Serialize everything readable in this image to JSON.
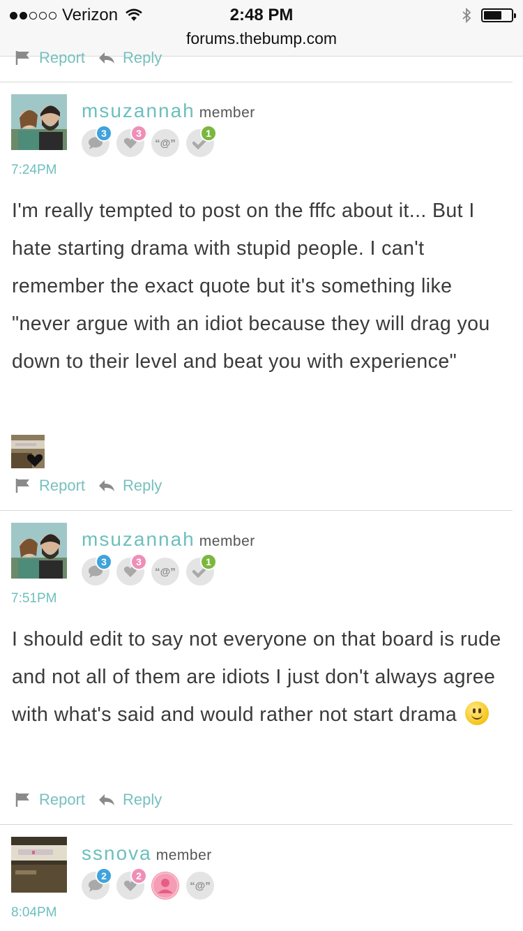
{
  "status_bar": {
    "carrier": "Verizon",
    "time": "2:48 PM",
    "url": "forums.thebump.com",
    "battery_level": 0.7
  },
  "actions": {
    "report_label": "Report",
    "reply_label": "Reply"
  },
  "posts": [
    {
      "username": "msuzannah",
      "role": "member",
      "badges": {
        "comments": "3",
        "likes": "3",
        "mention": "“@”",
        "accepted": "1"
      },
      "time": "7:24PM",
      "body": "I'm really tempted to post on the fffc about it... But I hate starting drama with stupid people. I can't remember the exact quote but it's something like \"never argue with an idiot because they will drag you down to their level and beat you with experience\""
    },
    {
      "username": "msuzannah",
      "role": "member",
      "badges": {
        "comments": "3",
        "likes": "3",
        "mention": "“@”",
        "accepted": "1"
      },
      "time": "7:51PM",
      "body": "I should edit to say not everyone on that board is rude and not all of them are idiots I just don't always agree with what's said and would rather not start drama"
    },
    {
      "username": "ssnova",
      "role": "member",
      "badges": {
        "comments": "2",
        "likes": "2",
        "mention": "“@”"
      },
      "time": "8:04PM"
    }
  ],
  "colors": {
    "accent": "#6cbfbd",
    "badge_blue": "#3fa3dc",
    "badge_pink": "#ef8fb8",
    "badge_green": "#7bb73f"
  }
}
